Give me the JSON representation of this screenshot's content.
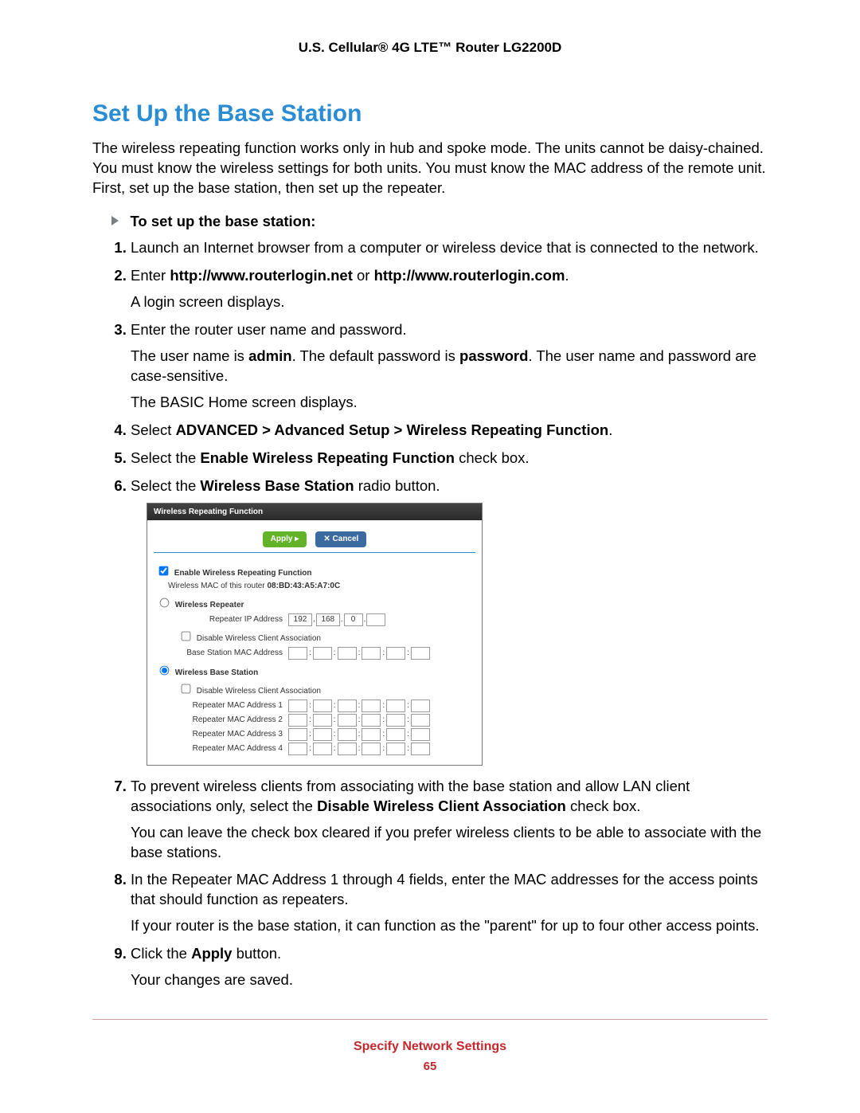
{
  "header": {
    "product": "U.S. Cellular® 4G LTE™ Router LG2200D"
  },
  "section_title": "Set Up the Base Station",
  "intro": "The wireless repeating function works only in hub and spoke mode. The units cannot be daisy-chained. You must know the wireless settings for both units. You must know the MAC address of the remote unit. First, set up the base station, then set up the repeater.",
  "task_heading": "To set up the base station:",
  "steps": {
    "s1": "Launch an Internet browser from a computer or wireless device that is connected to the network.",
    "s2_pre": "Enter ",
    "s2_bold": "http://www.routerlogin.net",
    "s2_mid": " or ",
    "s2_bold2": "http://www.routerlogin.com",
    "s2_end": ".",
    "s2_sub": "A login screen displays.",
    "s3": "Enter the router user name and password.",
    "s3_sub1_pre": "The user name is ",
    "s3_sub1_b1": "admin",
    "s3_sub1_mid": ". The default password is ",
    "s3_sub1_b2": "password",
    "s3_sub1_end": ". The user name and password are case-sensitive.",
    "s3_sub2": "The BASIC Home screen displays.",
    "s4_pre": "Select ",
    "s4_bold": "ADVANCED > Advanced Setup > Wireless Repeating Function",
    "s4_end": ".",
    "s5_pre": "Select the ",
    "s5_bold": "Enable Wireless Repeating Function",
    "s5_end": " check box.",
    "s6_pre": "Select the ",
    "s6_bold": "Wireless Base Station",
    "s6_end": " radio button.",
    "s7_pre": "To prevent wireless clients from associating with the base station and allow LAN client associations only, select the ",
    "s7_bold": "Disable Wireless Client Association",
    "s7_end": " check box.",
    "s7_sub": "You can leave the check box cleared if you prefer wireless clients to be able to associate with the base stations.",
    "s8": "In the Repeater MAC Address 1 through 4 fields, enter the MAC addresses for the access points that should function as repeaters.",
    "s8_sub": "If your router is the base station, it can function as the \"parent\" for up to four other access points.",
    "s9_pre": "Click the ",
    "s9_bold": "Apply",
    "s9_end": " button.",
    "s9_sub": "Your changes are saved."
  },
  "panel": {
    "title": "Wireless Repeating Function",
    "apply": "Apply ▸",
    "cancel": "✕ Cancel",
    "enable_label": "Enable Wireless Repeating Function",
    "mac_prefix": "Wireless MAC of this router ",
    "mac_value": "08:BD:43:A5:A7:0C",
    "repeater_label": "Wireless Repeater",
    "repeater_ip_label": "Repeater IP Address",
    "ip": {
      "o1": "192",
      "o2": "168",
      "o3": "0",
      "o4": ""
    },
    "disable_assoc_label": "Disable Wireless Client Association",
    "base_mac_label": "Base Station MAC Address",
    "base_station_label": "Wireless Base Station",
    "rep_mac1": "Repeater MAC Address 1",
    "rep_mac2": "Repeater MAC Address 2",
    "rep_mac3": "Repeater MAC Address 3",
    "rep_mac4": "Repeater MAC Address 4"
  },
  "footer": {
    "title": "Specify Network Settings",
    "page": "65"
  }
}
